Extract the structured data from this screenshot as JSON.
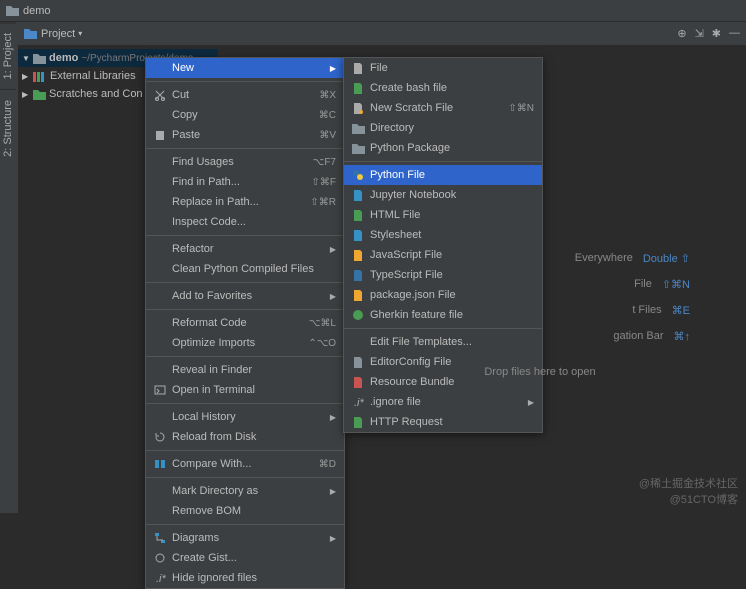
{
  "title": "demo",
  "project_bar": {
    "label": "Project"
  },
  "side_tabs": [
    "1: Project",
    "2: Structure"
  ],
  "tree": {
    "root": {
      "name": "demo",
      "path": "~/PycharmProjects/demo"
    },
    "items": [
      "External Libraries",
      "Scratches and Con"
    ]
  },
  "context_menu": [
    {
      "label": "New",
      "selected": true,
      "submenu": true,
      "icon": ""
    },
    {
      "sep": true
    },
    {
      "label": "Cut",
      "shortcut": "⌘X",
      "icon": "cut"
    },
    {
      "label": "Copy",
      "shortcut": "⌘C",
      "icon": ""
    },
    {
      "label": "Paste",
      "shortcut": "⌘V",
      "icon": "paste"
    },
    {
      "sep": true
    },
    {
      "label": "Find Usages",
      "shortcut": "⌥F7",
      "icon": ""
    },
    {
      "label": "Find in Path...",
      "shortcut": "⇧⌘F",
      "icon": ""
    },
    {
      "label": "Replace in Path...",
      "shortcut": "⇧⌘R",
      "icon": ""
    },
    {
      "label": "Inspect Code...",
      "icon": ""
    },
    {
      "sep": true
    },
    {
      "label": "Refactor",
      "submenu": true,
      "icon": ""
    },
    {
      "label": "Clean Python Compiled Files",
      "icon": ""
    },
    {
      "sep": true
    },
    {
      "label": "Add to Favorites",
      "submenu": true,
      "icon": ""
    },
    {
      "sep": true
    },
    {
      "label": "Reformat Code",
      "shortcut": "⌥⌘L",
      "icon": ""
    },
    {
      "label": "Optimize Imports",
      "shortcut": "⌃⌥O",
      "icon": ""
    },
    {
      "sep": true
    },
    {
      "label": "Reveal in Finder",
      "icon": ""
    },
    {
      "label": "Open in Terminal",
      "icon": "term"
    },
    {
      "sep": true
    },
    {
      "label": "Local History",
      "submenu": true,
      "icon": ""
    },
    {
      "label": "Reload from Disk",
      "icon": "reload"
    },
    {
      "sep": true
    },
    {
      "label": "Compare With...",
      "shortcut": "⌘D",
      "icon": "diff"
    },
    {
      "sep": true
    },
    {
      "label": "Mark Directory as",
      "submenu": true,
      "icon": ""
    },
    {
      "label": "Remove BOM",
      "icon": ""
    },
    {
      "sep": true
    },
    {
      "label": "Diagrams",
      "submenu": true,
      "icon": "diag"
    },
    {
      "label": "Create Gist...",
      "icon": "gist"
    },
    {
      "label": "Hide ignored files",
      "icon": "ign"
    }
  ],
  "new_submenu": [
    {
      "label": "File",
      "icon": "file"
    },
    {
      "label": "Create bash file",
      "icon": "bash"
    },
    {
      "label": "New Scratch File",
      "shortcut": "⇧⌘N",
      "icon": "scratch"
    },
    {
      "label": "Directory",
      "icon": "dir"
    },
    {
      "label": "Python Package",
      "icon": "dir"
    },
    {
      "sep": true
    },
    {
      "label": "Python File",
      "selected": true,
      "icon": "py"
    },
    {
      "label": "Jupyter Notebook",
      "icon": "jup"
    },
    {
      "label": "HTML File",
      "icon": "html"
    },
    {
      "label": "Stylesheet",
      "icon": "css"
    },
    {
      "label": "JavaScript File",
      "icon": "js"
    },
    {
      "label": "TypeScript File",
      "icon": "ts"
    },
    {
      "label": "package.json File",
      "icon": "json"
    },
    {
      "label": "Gherkin feature file",
      "icon": "gh"
    },
    {
      "sep": true
    },
    {
      "label": "Edit File Templates...",
      "icon": ""
    },
    {
      "label": "EditorConfig File",
      "icon": "ec"
    },
    {
      "label": "Resource Bundle",
      "icon": "rb"
    },
    {
      "label": ".ignore file",
      "submenu": true,
      "icon": "ign"
    },
    {
      "label": "HTTP Request",
      "icon": "http"
    }
  ],
  "welcome": {
    "rows": [
      {
        "text": "Everywhere",
        "key": "Double ⇧"
      },
      {
        "text": "File",
        "key": "⇧⌘N"
      },
      {
        "text": "t Files",
        "key": "⌘E"
      },
      {
        "text": "gation Bar",
        "key": "⌘↑"
      }
    ],
    "drop": "Drop files here to open"
  },
  "watermark": [
    "@稀土掘金技术社区",
    "@51CTO博客"
  ]
}
